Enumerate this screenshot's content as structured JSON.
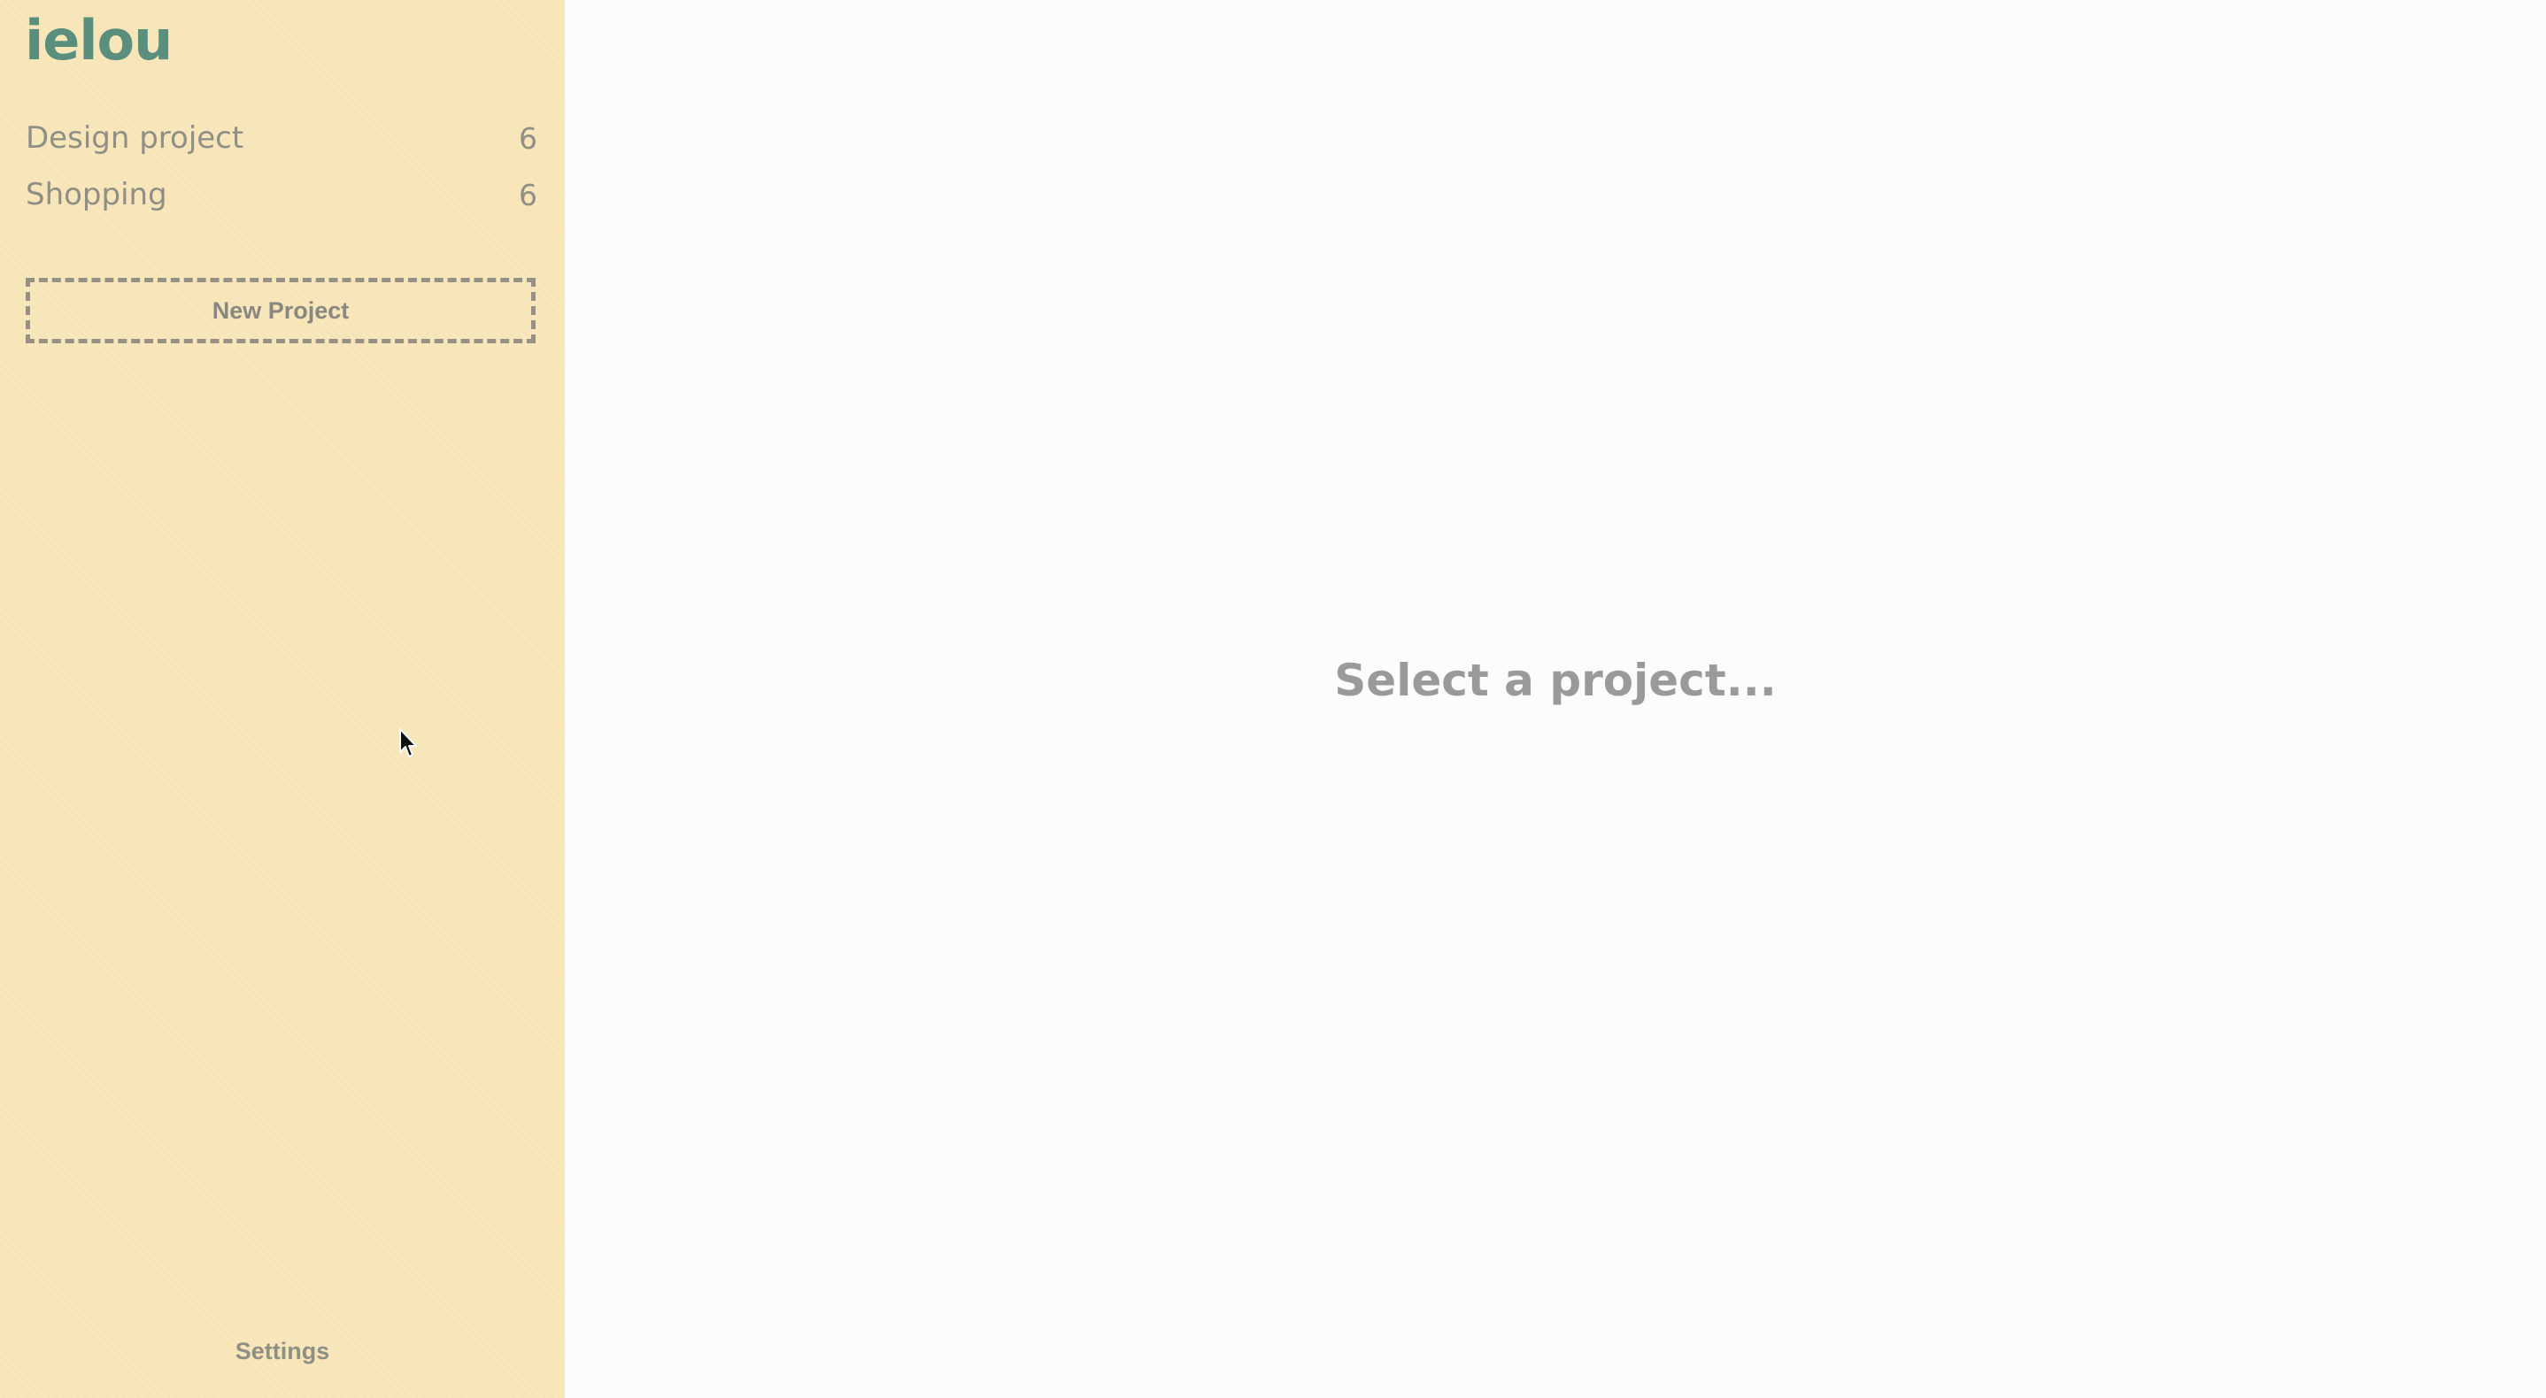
{
  "app": {
    "logo": "ielou"
  },
  "sidebar": {
    "projects": [
      {
        "name": "Design project",
        "count": "6"
      },
      {
        "name": "Shopping",
        "count": "6"
      }
    ],
    "new_project_label": "New Project",
    "settings_label": "Settings"
  },
  "main": {
    "placeholder": "Select a project..."
  },
  "colors": {
    "sidebar_bg": "#f7e5b7",
    "logo": "#5a8f7e",
    "text_muted": "#8f8f86",
    "main_bg": "#fcfcfc"
  },
  "icons": {
    "cursor": "mouse-pointer-icon"
  }
}
